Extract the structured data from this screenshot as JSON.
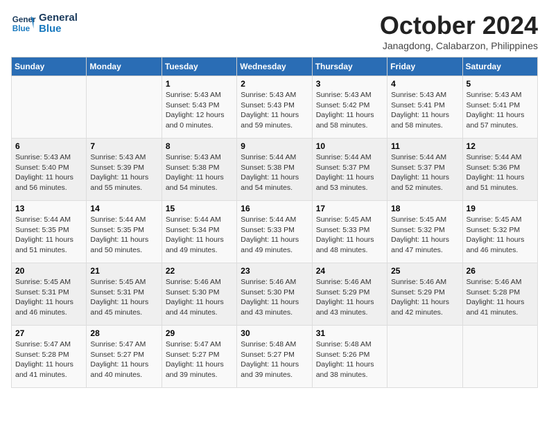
{
  "header": {
    "logo_line1": "General",
    "logo_line2": "Blue",
    "month": "October 2024",
    "location": "Janagdong, Calabarzon, Philippines"
  },
  "weekdays": [
    "Sunday",
    "Monday",
    "Tuesday",
    "Wednesday",
    "Thursday",
    "Friday",
    "Saturday"
  ],
  "weeks": [
    [
      {
        "day": "",
        "text": ""
      },
      {
        "day": "",
        "text": ""
      },
      {
        "day": "1",
        "text": "Sunrise: 5:43 AM\nSunset: 5:43 PM\nDaylight: 12 hours\nand 0 minutes."
      },
      {
        "day": "2",
        "text": "Sunrise: 5:43 AM\nSunset: 5:43 PM\nDaylight: 11 hours\nand 59 minutes."
      },
      {
        "day": "3",
        "text": "Sunrise: 5:43 AM\nSunset: 5:42 PM\nDaylight: 11 hours\nand 58 minutes."
      },
      {
        "day": "4",
        "text": "Sunrise: 5:43 AM\nSunset: 5:41 PM\nDaylight: 11 hours\nand 58 minutes."
      },
      {
        "day": "5",
        "text": "Sunrise: 5:43 AM\nSunset: 5:41 PM\nDaylight: 11 hours\nand 57 minutes."
      }
    ],
    [
      {
        "day": "6",
        "text": "Sunrise: 5:43 AM\nSunset: 5:40 PM\nDaylight: 11 hours\nand 56 minutes."
      },
      {
        "day": "7",
        "text": "Sunrise: 5:43 AM\nSunset: 5:39 PM\nDaylight: 11 hours\nand 55 minutes."
      },
      {
        "day": "8",
        "text": "Sunrise: 5:43 AM\nSunset: 5:38 PM\nDaylight: 11 hours\nand 54 minutes."
      },
      {
        "day": "9",
        "text": "Sunrise: 5:44 AM\nSunset: 5:38 PM\nDaylight: 11 hours\nand 54 minutes."
      },
      {
        "day": "10",
        "text": "Sunrise: 5:44 AM\nSunset: 5:37 PM\nDaylight: 11 hours\nand 53 minutes."
      },
      {
        "day": "11",
        "text": "Sunrise: 5:44 AM\nSunset: 5:37 PM\nDaylight: 11 hours\nand 52 minutes."
      },
      {
        "day": "12",
        "text": "Sunrise: 5:44 AM\nSunset: 5:36 PM\nDaylight: 11 hours\nand 51 minutes."
      }
    ],
    [
      {
        "day": "13",
        "text": "Sunrise: 5:44 AM\nSunset: 5:35 PM\nDaylight: 11 hours\nand 51 minutes."
      },
      {
        "day": "14",
        "text": "Sunrise: 5:44 AM\nSunset: 5:35 PM\nDaylight: 11 hours\nand 50 minutes."
      },
      {
        "day": "15",
        "text": "Sunrise: 5:44 AM\nSunset: 5:34 PM\nDaylight: 11 hours\nand 49 minutes."
      },
      {
        "day": "16",
        "text": "Sunrise: 5:44 AM\nSunset: 5:33 PM\nDaylight: 11 hours\nand 49 minutes."
      },
      {
        "day": "17",
        "text": "Sunrise: 5:45 AM\nSunset: 5:33 PM\nDaylight: 11 hours\nand 48 minutes."
      },
      {
        "day": "18",
        "text": "Sunrise: 5:45 AM\nSunset: 5:32 PM\nDaylight: 11 hours\nand 47 minutes."
      },
      {
        "day": "19",
        "text": "Sunrise: 5:45 AM\nSunset: 5:32 PM\nDaylight: 11 hours\nand 46 minutes."
      }
    ],
    [
      {
        "day": "20",
        "text": "Sunrise: 5:45 AM\nSunset: 5:31 PM\nDaylight: 11 hours\nand 46 minutes."
      },
      {
        "day": "21",
        "text": "Sunrise: 5:45 AM\nSunset: 5:31 PM\nDaylight: 11 hours\nand 45 minutes."
      },
      {
        "day": "22",
        "text": "Sunrise: 5:46 AM\nSunset: 5:30 PM\nDaylight: 11 hours\nand 44 minutes."
      },
      {
        "day": "23",
        "text": "Sunrise: 5:46 AM\nSunset: 5:30 PM\nDaylight: 11 hours\nand 43 minutes."
      },
      {
        "day": "24",
        "text": "Sunrise: 5:46 AM\nSunset: 5:29 PM\nDaylight: 11 hours\nand 43 minutes."
      },
      {
        "day": "25",
        "text": "Sunrise: 5:46 AM\nSunset: 5:29 PM\nDaylight: 11 hours\nand 42 minutes."
      },
      {
        "day": "26",
        "text": "Sunrise: 5:46 AM\nSunset: 5:28 PM\nDaylight: 11 hours\nand 41 minutes."
      }
    ],
    [
      {
        "day": "27",
        "text": "Sunrise: 5:47 AM\nSunset: 5:28 PM\nDaylight: 11 hours\nand 41 minutes."
      },
      {
        "day": "28",
        "text": "Sunrise: 5:47 AM\nSunset: 5:27 PM\nDaylight: 11 hours\nand 40 minutes."
      },
      {
        "day": "29",
        "text": "Sunrise: 5:47 AM\nSunset: 5:27 PM\nDaylight: 11 hours\nand 39 minutes."
      },
      {
        "day": "30",
        "text": "Sunrise: 5:48 AM\nSunset: 5:27 PM\nDaylight: 11 hours\nand 39 minutes."
      },
      {
        "day": "31",
        "text": "Sunrise: 5:48 AM\nSunset: 5:26 PM\nDaylight: 11 hours\nand 38 minutes."
      },
      {
        "day": "",
        "text": ""
      },
      {
        "day": "",
        "text": ""
      }
    ]
  ]
}
